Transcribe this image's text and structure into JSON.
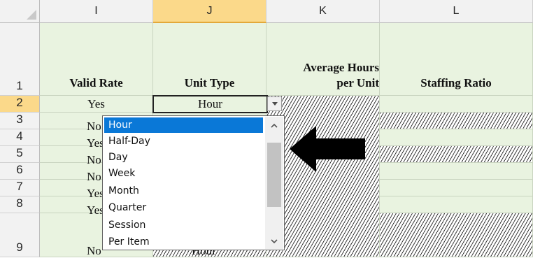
{
  "columns": [
    "I",
    "J",
    "K",
    "L"
  ],
  "rows": [
    "1",
    "2",
    "3",
    "4",
    "5",
    "6",
    "7",
    "8",
    "9"
  ],
  "header_row": {
    "valid_rate": "Valid Rate",
    "unit_type": "Unit Type",
    "avg_hours_line1": "Average Hours",
    "avg_hours_line2": "per Unit",
    "staffing_ratio": "Staffing Ratio"
  },
  "valid_rate_values": [
    "Yes",
    "No",
    "Yes",
    "No",
    "No",
    "Yes",
    "Yes",
    "No"
  ],
  "unit_type_value": "Hour",
  "row9_unit_type_partial": "Hour",
  "dropdown": {
    "options": [
      "Hour",
      "Half-Day",
      "Day",
      "Week",
      "Month",
      "Quarter",
      "Session",
      "Per Item"
    ],
    "selected": "Hour"
  },
  "colors": {
    "cell_fill": "#e9f3e0",
    "selected_header": "#fbd98a",
    "highlight": "#0a78d7"
  },
  "icons": [
    "dropdown-arrow-icon",
    "scroll-up-icon",
    "scroll-down-icon",
    "left-arrow-icon"
  ]
}
